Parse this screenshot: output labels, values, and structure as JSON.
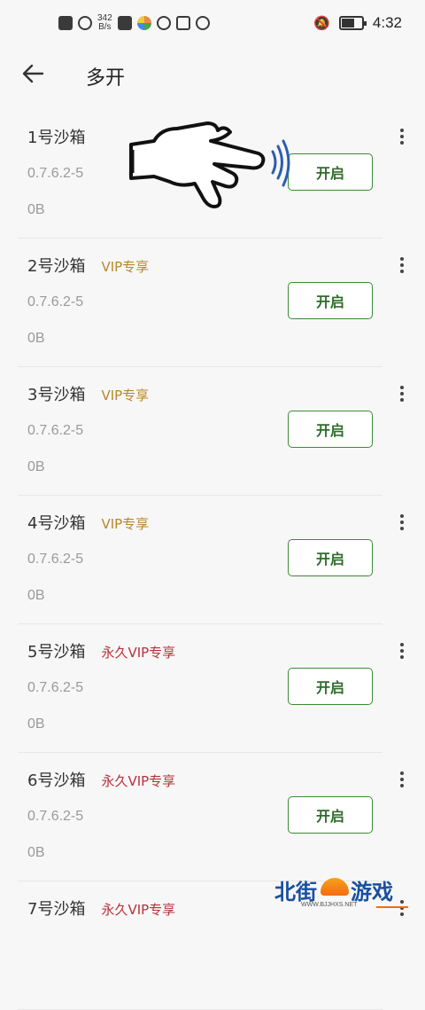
{
  "status_bar": {
    "speed_value": "342",
    "speed_unit": "B/s",
    "time": "4:32"
  },
  "header": {
    "title": "多开"
  },
  "sandboxes": [
    {
      "name": "1号沙箱",
      "badge": "",
      "badge_type": "none",
      "version": "0.7.6.2-5",
      "size": "0B",
      "button": "开启"
    },
    {
      "name": "2号沙箱",
      "badge": "VIP专享",
      "badge_type": "vip",
      "version": "0.7.6.2-5",
      "size": "0B",
      "button": "开启"
    },
    {
      "name": "3号沙箱",
      "badge": "VIP专享",
      "badge_type": "vip",
      "version": "0.7.6.2-5",
      "size": "0B",
      "button": "开启"
    },
    {
      "name": "4号沙箱",
      "badge": "VIP专享",
      "badge_type": "vip",
      "version": "0.7.6.2-5",
      "size": "0B",
      "button": "开启"
    },
    {
      "name": "5号沙箱",
      "badge": "永久VIP专享",
      "badge_type": "perm",
      "version": "0.7.6.2-5",
      "size": "0B",
      "button": "开启"
    },
    {
      "name": "6号沙箱",
      "badge": "永久VIP专享",
      "badge_type": "perm",
      "version": "0.7.6.2-5",
      "size": "0B",
      "button": "开启"
    },
    {
      "name": "7号沙箱",
      "badge": "永久VIP专享",
      "badge_type": "perm",
      "version": "",
      "size": "",
      "button": ""
    }
  ],
  "watermark": {
    "left": "北街",
    "right": "游戏",
    "sub": "WWW.BJJHXS.NET"
  },
  "colors": {
    "accent_green": "#3c8a35",
    "vip_gold": "#b8862a",
    "permanent_red": "#b8303a"
  }
}
